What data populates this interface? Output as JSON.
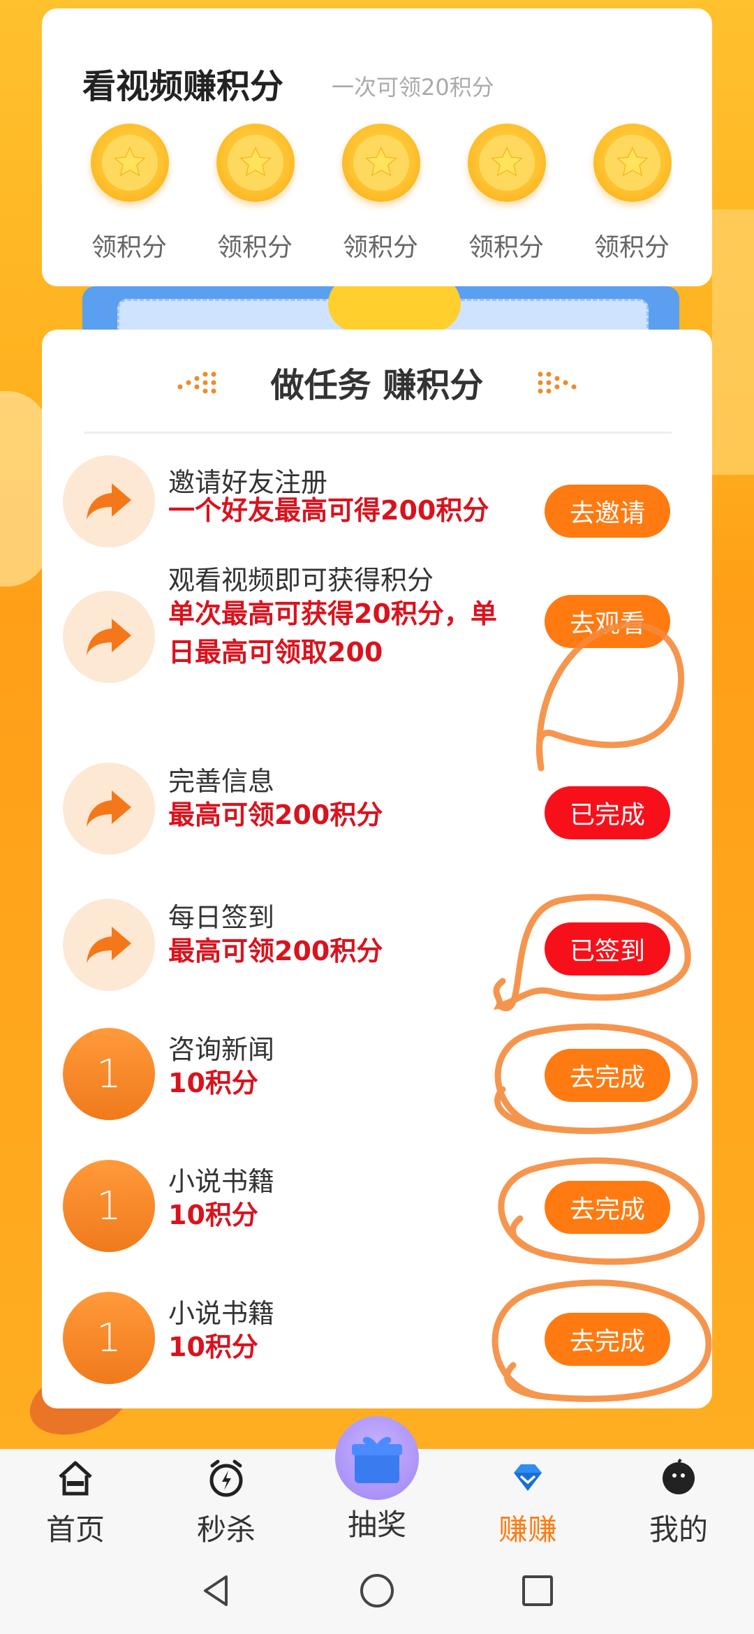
{
  "video_card": {
    "title": "看视频赚积分",
    "subtitle": "一次可领20积分",
    "coins": [
      {
        "label": "领积分"
      },
      {
        "label": "领积分"
      },
      {
        "label": "领积分"
      },
      {
        "label": "领积分"
      },
      {
        "label": "领积分"
      }
    ]
  },
  "task_card": {
    "header": "做任务 赚积分",
    "tasks": [
      {
        "icon": "share-arrow-icon",
        "title": "邀请好友注册",
        "desc_lines": [
          "一个好友最高可得200积分"
        ],
        "button": "去邀请",
        "button_color": "#ff7a10"
      },
      {
        "icon": "share-arrow-icon",
        "title": "观看视频即可获得积分",
        "desc_lines": [
          "单次最高可获得20积分，单",
          "日最高可领取200"
        ],
        "button": "去观看",
        "button_color": "#ff7a10"
      },
      {
        "icon": "share-arrow-icon",
        "title": "完善信息",
        "desc_lines": [
          "最高可领200积分"
        ],
        "button": "已完成",
        "button_color": "#f7101a"
      },
      {
        "icon": "share-arrow-icon",
        "title": "每日签到",
        "desc_lines": [
          "最高可领200积分"
        ],
        "button": "已签到",
        "button_color": "#f7101a"
      },
      {
        "icon_text": "1",
        "title": "咨询新闻",
        "desc_lines": [
          "10积分"
        ],
        "button": "去完成",
        "button_color": "#ff7a10"
      },
      {
        "icon_text": "1",
        "title": "小说书籍",
        "desc_lines": [
          "10积分"
        ],
        "button": "去完成",
        "button_color": "#ff7a10"
      },
      {
        "icon_text": "1",
        "title": "小说书籍",
        "desc_lines": [
          "10积分"
        ],
        "button": "去完成",
        "button_color": "#ff7a10"
      }
    ]
  },
  "tabbar": {
    "tabs": [
      {
        "label": "首页",
        "icon": "home-icon"
      },
      {
        "label": "秒杀",
        "icon": "flash-clock-icon"
      },
      {
        "label": "抽奖",
        "icon": "gift-icon"
      },
      {
        "label": "赚赚",
        "icon": "diamond-icon",
        "active": true
      },
      {
        "label": "我的",
        "icon": "profile-icon"
      }
    ]
  },
  "system_nav": [
    "back-icon",
    "home-circle-icon",
    "recents-icon"
  ],
  "colors": {
    "accent_orange": "#ff7a10",
    "done_red": "#f7101a",
    "desc_red": "#d9131e",
    "background": "#ffb020"
  }
}
